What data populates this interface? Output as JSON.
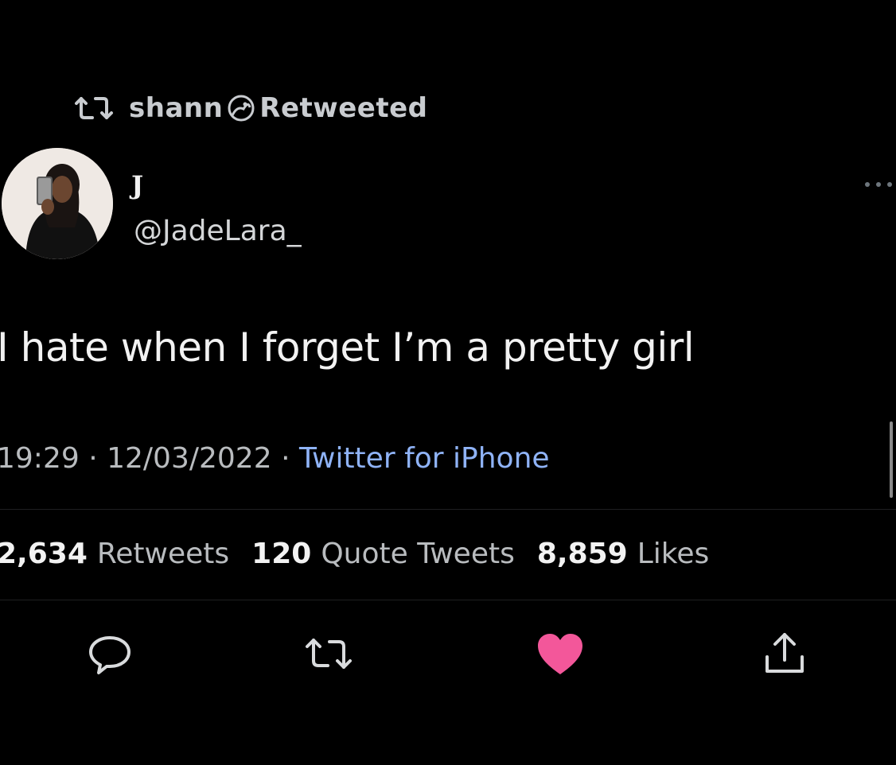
{
  "retweet_context": {
    "name": "shann",
    "label": "Retweeted"
  },
  "author": {
    "display_name": "J",
    "handle": "@JadeLara_"
  },
  "tweet": {
    "text": "I hate when I forget I’m a pretty girl",
    "time": "19:29",
    "date": "12/03/2022",
    "separator": "·",
    "source": "Twitter for iPhone"
  },
  "stats": [
    {
      "count": "2,634",
      "label": "Retweets"
    },
    {
      "count": "120",
      "label": "Quote Tweets"
    },
    {
      "count": "8,859",
      "label": "Likes"
    }
  ],
  "actions": {
    "reply_icon": "reply-icon",
    "retweet_icon": "retweet-icon",
    "like_icon": "heart-icon",
    "share_icon": "share-icon",
    "liked": true
  },
  "colors": {
    "background": "#000000",
    "text": "#f2f2f2",
    "secondary": "#b9bcbf",
    "link": "#8fb3f7",
    "like": "#f3579a"
  }
}
